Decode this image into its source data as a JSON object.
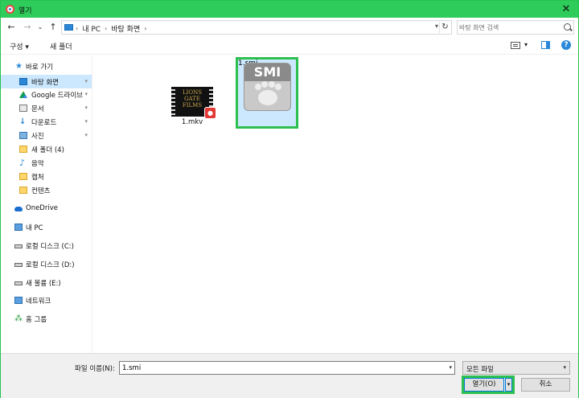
{
  "window": {
    "title": "열기",
    "close_glyph": "✕",
    "accent_color": "#2ecc5a"
  },
  "nav": {
    "back_glyph": "←",
    "forward_glyph": "→",
    "recent_glyph": "⌄",
    "up_glyph": "↑",
    "breadcrumbs": [
      "내 PC",
      "바탕 화면"
    ],
    "refresh_glyph": "↻",
    "search_placeholder": "바탕 화면 검색"
  },
  "toolbar": {
    "organize_label": "구성 ▾",
    "new_folder_label": "새 폴더",
    "view_dropdown": "▾"
  },
  "sidebar": {
    "items": [
      {
        "label": "바로 가기",
        "icon": "star-icon"
      },
      {
        "label": "바탕 화면",
        "icon": "desktop-icon",
        "pinned": true,
        "selected": true
      },
      {
        "label": "Google 드라이브",
        "icon": "google-drive-icon",
        "pinned": true
      },
      {
        "label": "문서",
        "icon": "document-icon",
        "pinned": true
      },
      {
        "label": "다운로드",
        "icon": "download-icon",
        "pinned": true
      },
      {
        "label": "사진",
        "icon": "picture-icon",
        "pinned": true
      },
      {
        "label": "새 폴더 (4)",
        "icon": "folder-icon"
      },
      {
        "label": "음악",
        "icon": "music-icon"
      },
      {
        "label": "캡처",
        "icon": "folder-icon"
      },
      {
        "label": "컨텐츠",
        "icon": "folder-icon"
      },
      {
        "label": "OneDrive",
        "icon": "cloud-icon"
      },
      {
        "label": "내 PC",
        "icon": "pc-icon"
      },
      {
        "label": "로컬 디스크 (C:)",
        "icon": "drive-icon"
      },
      {
        "label": "로컬 디스크 (D:)",
        "icon": "drive-icon"
      },
      {
        "label": "새 볼륨 (E:)",
        "icon": "drive-icon"
      },
      {
        "label": "네트워크",
        "icon": "network-icon"
      },
      {
        "label": "홈 그룹",
        "icon": "homegroup-icon"
      }
    ],
    "pin_glyph": "📌"
  },
  "files": [
    {
      "name": "1.mkv",
      "thumb_text": "LIONS GATE FILMS"
    },
    {
      "name": "1.smi",
      "icon_text": "SMI",
      "selected": true
    }
  ],
  "footer": {
    "filename_label": "파일 이름(N):",
    "filename_value": "1.smi",
    "filetype_value": "모든 파일",
    "open_label": "열기(O)",
    "cancel_label": "취소",
    "dropdown_glyph": "▾"
  }
}
